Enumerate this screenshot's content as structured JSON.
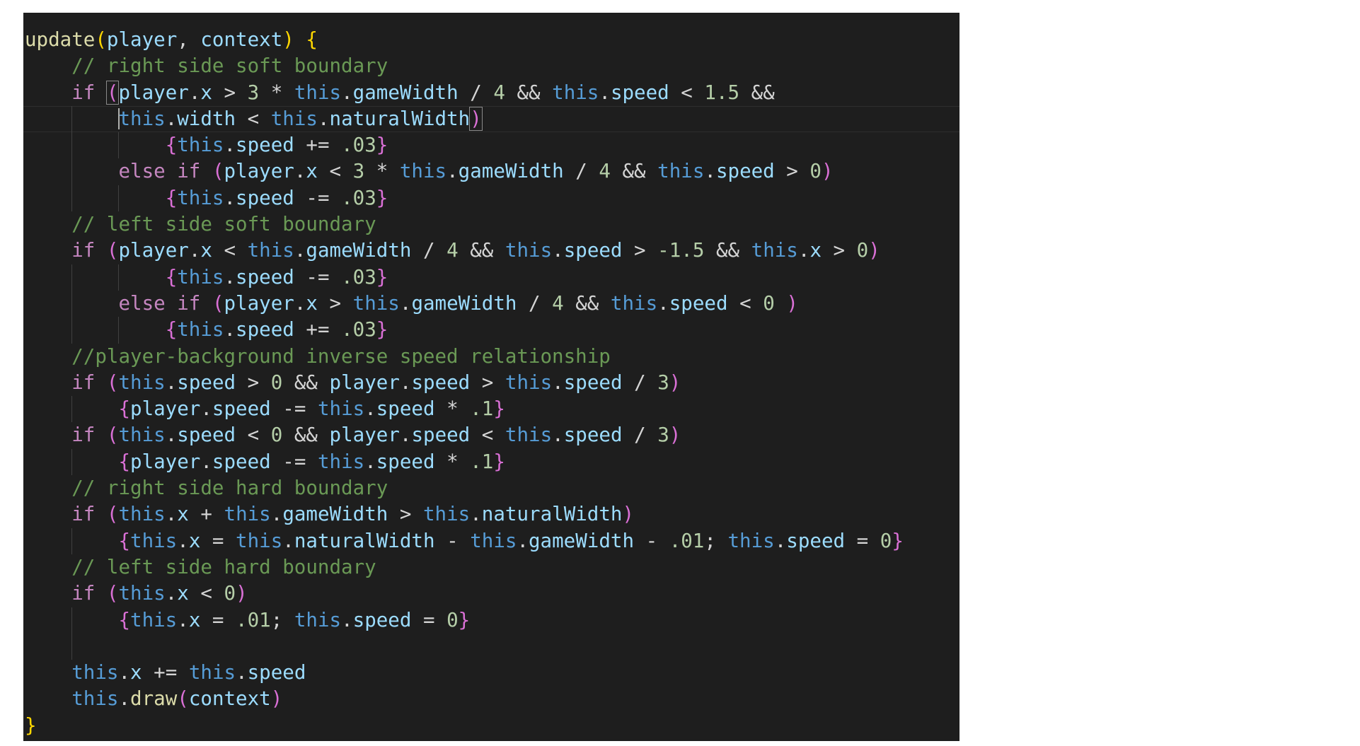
{
  "editor": {
    "colors": {
      "background": "#1e1e1e",
      "keyword": "#c586c0",
      "this": "#569cd6",
      "function": "#dcdcaa",
      "variable": "#9cdcfe",
      "number": "#b5cea8",
      "comment": "#6a9955",
      "bracket1": "#ffd700",
      "bracket2": "#da70d6"
    },
    "lines": [
      {
        "indent": 0,
        "tokens": [
          [
            "fn",
            "update"
          ],
          [
            "b1",
            "("
          ],
          [
            "var",
            "player"
          ],
          [
            "op",
            ", "
          ],
          [
            "var",
            "context"
          ],
          [
            "b1",
            ")"
          ],
          [
            "op",
            " "
          ],
          [
            "b1",
            "{"
          ]
        ]
      },
      {
        "indent": 4,
        "tokens": [
          [
            "cm",
            "// right side soft boundary"
          ]
        ]
      },
      {
        "indent": 4,
        "tokens": [
          [
            "kw",
            "if"
          ],
          [
            "op",
            " "
          ],
          [
            "b2m",
            "("
          ],
          [
            "var",
            "player"
          ],
          [
            "op",
            "."
          ],
          [
            "prop",
            "x"
          ],
          [
            "op",
            " > "
          ],
          [
            "num",
            "3"
          ],
          [
            "op",
            " * "
          ],
          [
            "this",
            "this"
          ],
          [
            "op",
            "."
          ],
          [
            "prop",
            "gameWidth"
          ],
          [
            "op",
            " / "
          ],
          [
            "num",
            "4"
          ],
          [
            "op",
            " && "
          ],
          [
            "this",
            "this"
          ],
          [
            "op",
            "."
          ],
          [
            "prop",
            "speed"
          ],
          [
            "op",
            " < "
          ],
          [
            "num",
            "1.5"
          ],
          [
            "op",
            " &&"
          ]
        ]
      },
      {
        "indent": 8,
        "current": true,
        "cursor": true,
        "tokens": [
          [
            "this",
            "this"
          ],
          [
            "op",
            "."
          ],
          [
            "prop",
            "width"
          ],
          [
            "op",
            " < "
          ],
          [
            "this",
            "this"
          ],
          [
            "op",
            "."
          ],
          [
            "prop",
            "naturalWidth"
          ],
          [
            "b2m",
            ")"
          ]
        ]
      },
      {
        "indent": 12,
        "tokens": [
          [
            "b2",
            "{"
          ],
          [
            "this",
            "this"
          ],
          [
            "op",
            "."
          ],
          [
            "prop",
            "speed"
          ],
          [
            "op",
            " += "
          ],
          [
            "num",
            ".03"
          ],
          [
            "b2",
            "}"
          ]
        ]
      },
      {
        "indent": 8,
        "tokens": [
          [
            "kw",
            "else"
          ],
          [
            "op",
            " "
          ],
          [
            "kw",
            "if"
          ],
          [
            "op",
            " "
          ],
          [
            "b2",
            "("
          ],
          [
            "var",
            "player"
          ],
          [
            "op",
            "."
          ],
          [
            "prop",
            "x"
          ],
          [
            "op",
            " < "
          ],
          [
            "num",
            "3"
          ],
          [
            "op",
            " * "
          ],
          [
            "this",
            "this"
          ],
          [
            "op",
            "."
          ],
          [
            "prop",
            "gameWidth"
          ],
          [
            "op",
            " / "
          ],
          [
            "num",
            "4"
          ],
          [
            "op",
            " && "
          ],
          [
            "this",
            "this"
          ],
          [
            "op",
            "."
          ],
          [
            "prop",
            "speed"
          ],
          [
            "op",
            " > "
          ],
          [
            "num",
            "0"
          ],
          [
            "b2",
            ")"
          ]
        ]
      },
      {
        "indent": 12,
        "tokens": [
          [
            "b2",
            "{"
          ],
          [
            "this",
            "this"
          ],
          [
            "op",
            "."
          ],
          [
            "prop",
            "speed"
          ],
          [
            "op",
            " -= "
          ],
          [
            "num",
            ".03"
          ],
          [
            "b2",
            "}"
          ]
        ]
      },
      {
        "indent": 4,
        "tokens": [
          [
            "cm",
            "// left side soft boundary"
          ]
        ]
      },
      {
        "indent": 4,
        "tokens": [
          [
            "kw",
            "if"
          ],
          [
            "op",
            " "
          ],
          [
            "b2",
            "("
          ],
          [
            "var",
            "player"
          ],
          [
            "op",
            "."
          ],
          [
            "prop",
            "x"
          ],
          [
            "op",
            " < "
          ],
          [
            "this",
            "this"
          ],
          [
            "op",
            "."
          ],
          [
            "prop",
            "gameWidth"
          ],
          [
            "op",
            " / "
          ],
          [
            "num",
            "4"
          ],
          [
            "op",
            " && "
          ],
          [
            "this",
            "this"
          ],
          [
            "op",
            "."
          ],
          [
            "prop",
            "speed"
          ],
          [
            "op",
            " > "
          ],
          [
            "num",
            "-1.5"
          ],
          [
            "op",
            " && "
          ],
          [
            "this",
            "this"
          ],
          [
            "op",
            "."
          ],
          [
            "prop",
            "x"
          ],
          [
            "op",
            " > "
          ],
          [
            "num",
            "0"
          ],
          [
            "b2",
            ")"
          ]
        ]
      },
      {
        "indent": 12,
        "tokens": [
          [
            "b2",
            "{"
          ],
          [
            "this",
            "this"
          ],
          [
            "op",
            "."
          ],
          [
            "prop",
            "speed"
          ],
          [
            "op",
            " -= "
          ],
          [
            "num",
            ".03"
          ],
          [
            "b2",
            "}"
          ]
        ]
      },
      {
        "indent": 8,
        "tokens": [
          [
            "kw",
            "else"
          ],
          [
            "op",
            " "
          ],
          [
            "kw",
            "if"
          ],
          [
            "op",
            " "
          ],
          [
            "b2",
            "("
          ],
          [
            "var",
            "player"
          ],
          [
            "op",
            "."
          ],
          [
            "prop",
            "x"
          ],
          [
            "op",
            " > "
          ],
          [
            "this",
            "this"
          ],
          [
            "op",
            "."
          ],
          [
            "prop",
            "gameWidth"
          ],
          [
            "op",
            " / "
          ],
          [
            "num",
            "4"
          ],
          [
            "op",
            " && "
          ],
          [
            "this",
            "this"
          ],
          [
            "op",
            "."
          ],
          [
            "prop",
            "speed"
          ],
          [
            "op",
            " < "
          ],
          [
            "num",
            "0"
          ],
          [
            "op",
            " "
          ],
          [
            "b2",
            ")"
          ]
        ]
      },
      {
        "indent": 12,
        "tokens": [
          [
            "b2",
            "{"
          ],
          [
            "this",
            "this"
          ],
          [
            "op",
            "."
          ],
          [
            "prop",
            "speed"
          ],
          [
            "op",
            " += "
          ],
          [
            "num",
            ".03"
          ],
          [
            "b2",
            "}"
          ]
        ]
      },
      {
        "indent": 4,
        "tokens": [
          [
            "cm",
            "//player-background inverse speed relationship"
          ]
        ]
      },
      {
        "indent": 4,
        "tokens": [
          [
            "kw",
            "if"
          ],
          [
            "op",
            " "
          ],
          [
            "b2",
            "("
          ],
          [
            "this",
            "this"
          ],
          [
            "op",
            "."
          ],
          [
            "prop",
            "speed"
          ],
          [
            "op",
            " > "
          ],
          [
            "num",
            "0"
          ],
          [
            "op",
            " && "
          ],
          [
            "var",
            "player"
          ],
          [
            "op",
            "."
          ],
          [
            "prop",
            "speed"
          ],
          [
            "op",
            " > "
          ],
          [
            "this",
            "this"
          ],
          [
            "op",
            "."
          ],
          [
            "prop",
            "speed"
          ],
          [
            "op",
            " / "
          ],
          [
            "num",
            "3"
          ],
          [
            "b2",
            ")"
          ]
        ]
      },
      {
        "indent": 8,
        "tokens": [
          [
            "b2",
            "{"
          ],
          [
            "var",
            "player"
          ],
          [
            "op",
            "."
          ],
          [
            "prop",
            "speed"
          ],
          [
            "op",
            " -= "
          ],
          [
            "this",
            "this"
          ],
          [
            "op",
            "."
          ],
          [
            "prop",
            "speed"
          ],
          [
            "op",
            " * "
          ],
          [
            "num",
            ".1"
          ],
          [
            "b2",
            "}"
          ]
        ]
      },
      {
        "indent": 4,
        "tokens": [
          [
            "kw",
            "if"
          ],
          [
            "op",
            " "
          ],
          [
            "b2",
            "("
          ],
          [
            "this",
            "this"
          ],
          [
            "op",
            "."
          ],
          [
            "prop",
            "speed"
          ],
          [
            "op",
            " < "
          ],
          [
            "num",
            "0"
          ],
          [
            "op",
            " && "
          ],
          [
            "var",
            "player"
          ],
          [
            "op",
            "."
          ],
          [
            "prop",
            "speed"
          ],
          [
            "op",
            " < "
          ],
          [
            "this",
            "this"
          ],
          [
            "op",
            "."
          ],
          [
            "prop",
            "speed"
          ],
          [
            "op",
            " / "
          ],
          [
            "num",
            "3"
          ],
          [
            "b2",
            ")"
          ]
        ]
      },
      {
        "indent": 8,
        "tokens": [
          [
            "b2",
            "{"
          ],
          [
            "var",
            "player"
          ],
          [
            "op",
            "."
          ],
          [
            "prop",
            "speed"
          ],
          [
            "op",
            " -= "
          ],
          [
            "this",
            "this"
          ],
          [
            "op",
            "."
          ],
          [
            "prop",
            "speed"
          ],
          [
            "op",
            " * "
          ],
          [
            "num",
            ".1"
          ],
          [
            "b2",
            "}"
          ]
        ]
      },
      {
        "indent": 4,
        "tokens": [
          [
            "cm",
            "// right side hard boundary"
          ]
        ]
      },
      {
        "indent": 4,
        "tokens": [
          [
            "kw",
            "if"
          ],
          [
            "op",
            " "
          ],
          [
            "b2",
            "("
          ],
          [
            "this",
            "this"
          ],
          [
            "op",
            "."
          ],
          [
            "prop",
            "x"
          ],
          [
            "op",
            " + "
          ],
          [
            "this",
            "this"
          ],
          [
            "op",
            "."
          ],
          [
            "prop",
            "gameWidth"
          ],
          [
            "op",
            " > "
          ],
          [
            "this",
            "this"
          ],
          [
            "op",
            "."
          ],
          [
            "prop",
            "naturalWidth"
          ],
          [
            "b2",
            ")"
          ]
        ]
      },
      {
        "indent": 8,
        "tokens": [
          [
            "b2",
            "{"
          ],
          [
            "this",
            "this"
          ],
          [
            "op",
            "."
          ],
          [
            "prop",
            "x"
          ],
          [
            "op",
            " = "
          ],
          [
            "this",
            "this"
          ],
          [
            "op",
            "."
          ],
          [
            "prop",
            "naturalWidth"
          ],
          [
            "op",
            " - "
          ],
          [
            "this",
            "this"
          ],
          [
            "op",
            "."
          ],
          [
            "prop",
            "gameWidth"
          ],
          [
            "op",
            " - "
          ],
          [
            "num",
            ".01"
          ],
          [
            "op",
            "; "
          ],
          [
            "this",
            "this"
          ],
          [
            "op",
            "."
          ],
          [
            "prop",
            "speed"
          ],
          [
            "op",
            " = "
          ],
          [
            "num",
            "0"
          ],
          [
            "b2",
            "}"
          ]
        ]
      },
      {
        "indent": 4,
        "tokens": [
          [
            "cm",
            "// left side hard boundary"
          ]
        ]
      },
      {
        "indent": 4,
        "tokens": [
          [
            "kw",
            "if"
          ],
          [
            "op",
            " "
          ],
          [
            "b2",
            "("
          ],
          [
            "this",
            "this"
          ],
          [
            "op",
            "."
          ],
          [
            "prop",
            "x"
          ],
          [
            "op",
            " < "
          ],
          [
            "num",
            "0"
          ],
          [
            "b2",
            ")"
          ]
        ]
      },
      {
        "indent": 8,
        "tokens": [
          [
            "b2",
            "{"
          ],
          [
            "this",
            "this"
          ],
          [
            "op",
            "."
          ],
          [
            "prop",
            "x"
          ],
          [
            "op",
            " = "
          ],
          [
            "num",
            ".01"
          ],
          [
            "op",
            "; "
          ],
          [
            "this",
            "this"
          ],
          [
            "op",
            "."
          ],
          [
            "prop",
            "speed"
          ],
          [
            "op",
            " = "
          ],
          [
            "num",
            "0"
          ],
          [
            "b2",
            "}"
          ]
        ]
      },
      {
        "indent": 0,
        "tokens": []
      },
      {
        "indent": 4,
        "tokens": [
          [
            "this",
            "this"
          ],
          [
            "op",
            "."
          ],
          [
            "prop",
            "x"
          ],
          [
            "op",
            " += "
          ],
          [
            "this",
            "this"
          ],
          [
            "op",
            "."
          ],
          [
            "prop",
            "speed"
          ]
        ]
      },
      {
        "indent": 4,
        "tokens": [
          [
            "this",
            "this"
          ],
          [
            "op",
            "."
          ],
          [
            "fn",
            "draw"
          ],
          [
            "b2",
            "("
          ],
          [
            "var",
            "context"
          ],
          [
            "b2",
            ")"
          ]
        ]
      },
      {
        "indent": 0,
        "tokens": [
          [
            "b1",
            "}"
          ]
        ]
      }
    ]
  }
}
